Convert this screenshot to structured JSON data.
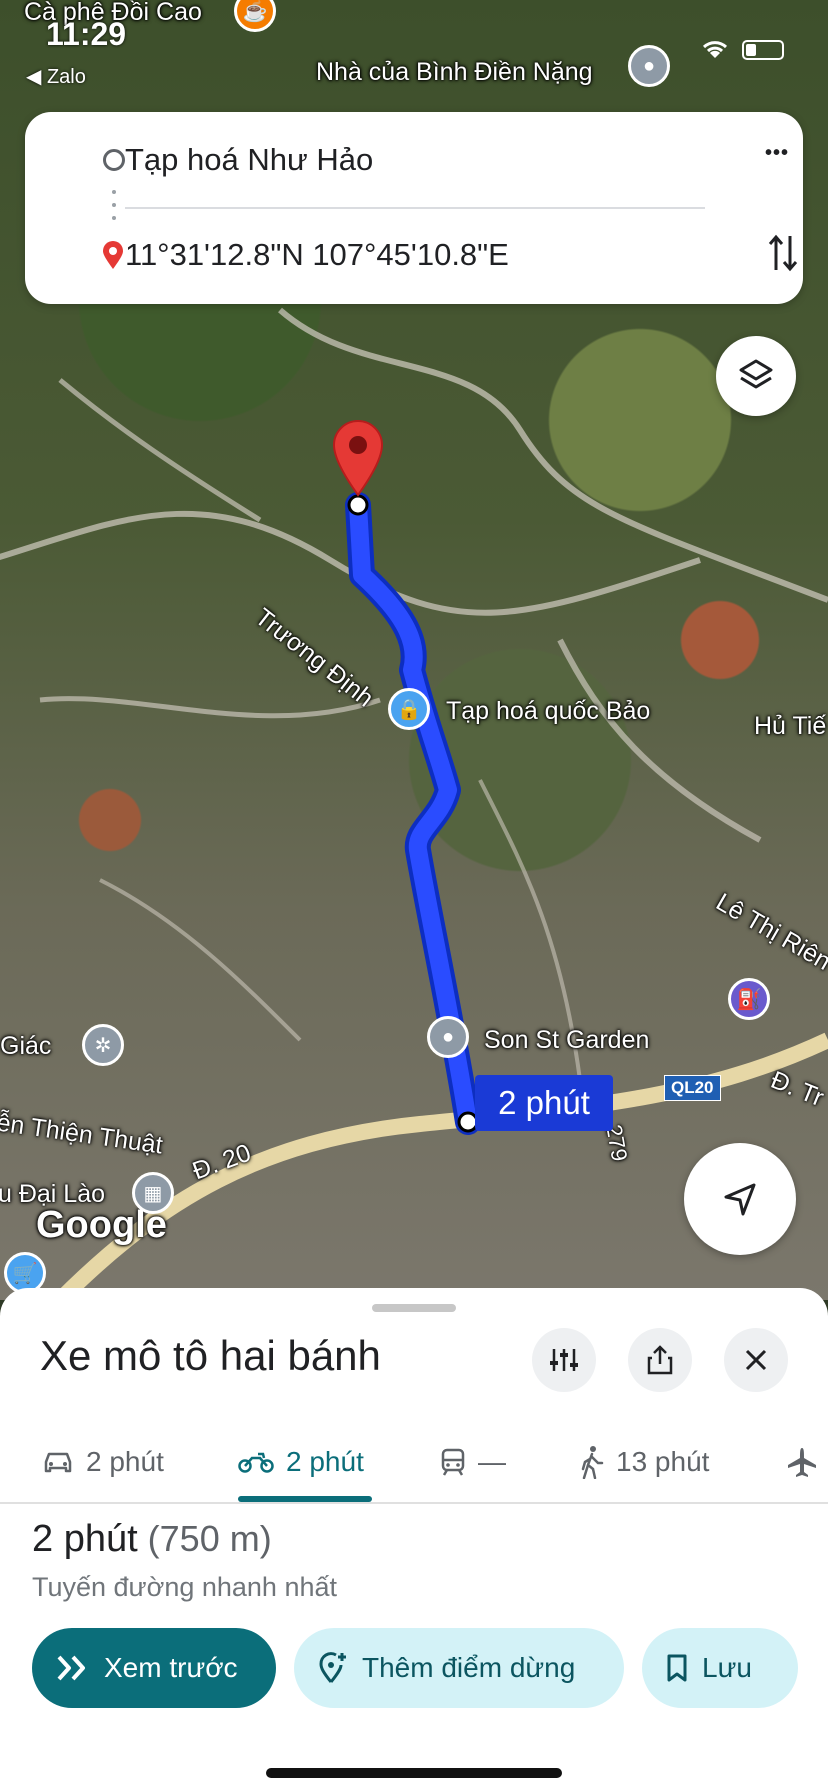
{
  "status_bar": {
    "time": "11:29",
    "back_app": "Zalo"
  },
  "map": {
    "labels": {
      "cafe": "Cà phê Đồi Cao",
      "house": "Nhà của Bình Điền Nặng",
      "street_truong_dinh": "Trương Định",
      "shop_quoc_bao": "Tạp hoá quốc Bảo",
      "garden": "Son St Garden",
      "road_d20": "Đ. 20",
      "ql20": "QL20",
      "road_d_tr": "Đ. Tr",
      "street_nguyen": "ễn Thiện Thuật",
      "temple": "u Đại Lào",
      "giac": "Giác",
      "hu_tieu": "Hủ Tiế",
      "le_thi_rieng": "Lê Thị Riên",
      "road_279": "279",
      "google": "Google"
    },
    "route_time_chip": "2 phút"
  },
  "route_card": {
    "origin": "Tạp hoá Như Hảo",
    "destination": "11°31'12.8\"N 107°45'10.8\"E",
    "more_label": "•••"
  },
  "sheet": {
    "title": "Xe mô tô hai bánh",
    "tabs": [
      {
        "mode": "car",
        "label": "2 phút"
      },
      {
        "mode": "motorbike",
        "label": "2 phút"
      },
      {
        "mode": "transit",
        "label": "—"
      },
      {
        "mode": "walk",
        "label": "13 phút"
      }
    ],
    "active_tab": "motorbike",
    "summary": {
      "time": "2 phút",
      "distance": "(750 m)",
      "subtitle": "Tuyến đường nhanh nhất"
    },
    "actions": {
      "preview": "Xem trước",
      "add_stop": "Thêm điểm dừng",
      "save": "Lưu"
    }
  },
  "colors": {
    "accent": "#0b6e7a",
    "route": "#1a3ad6",
    "pin": "#e53935",
    "chip_bg": "#d3f2f7"
  }
}
